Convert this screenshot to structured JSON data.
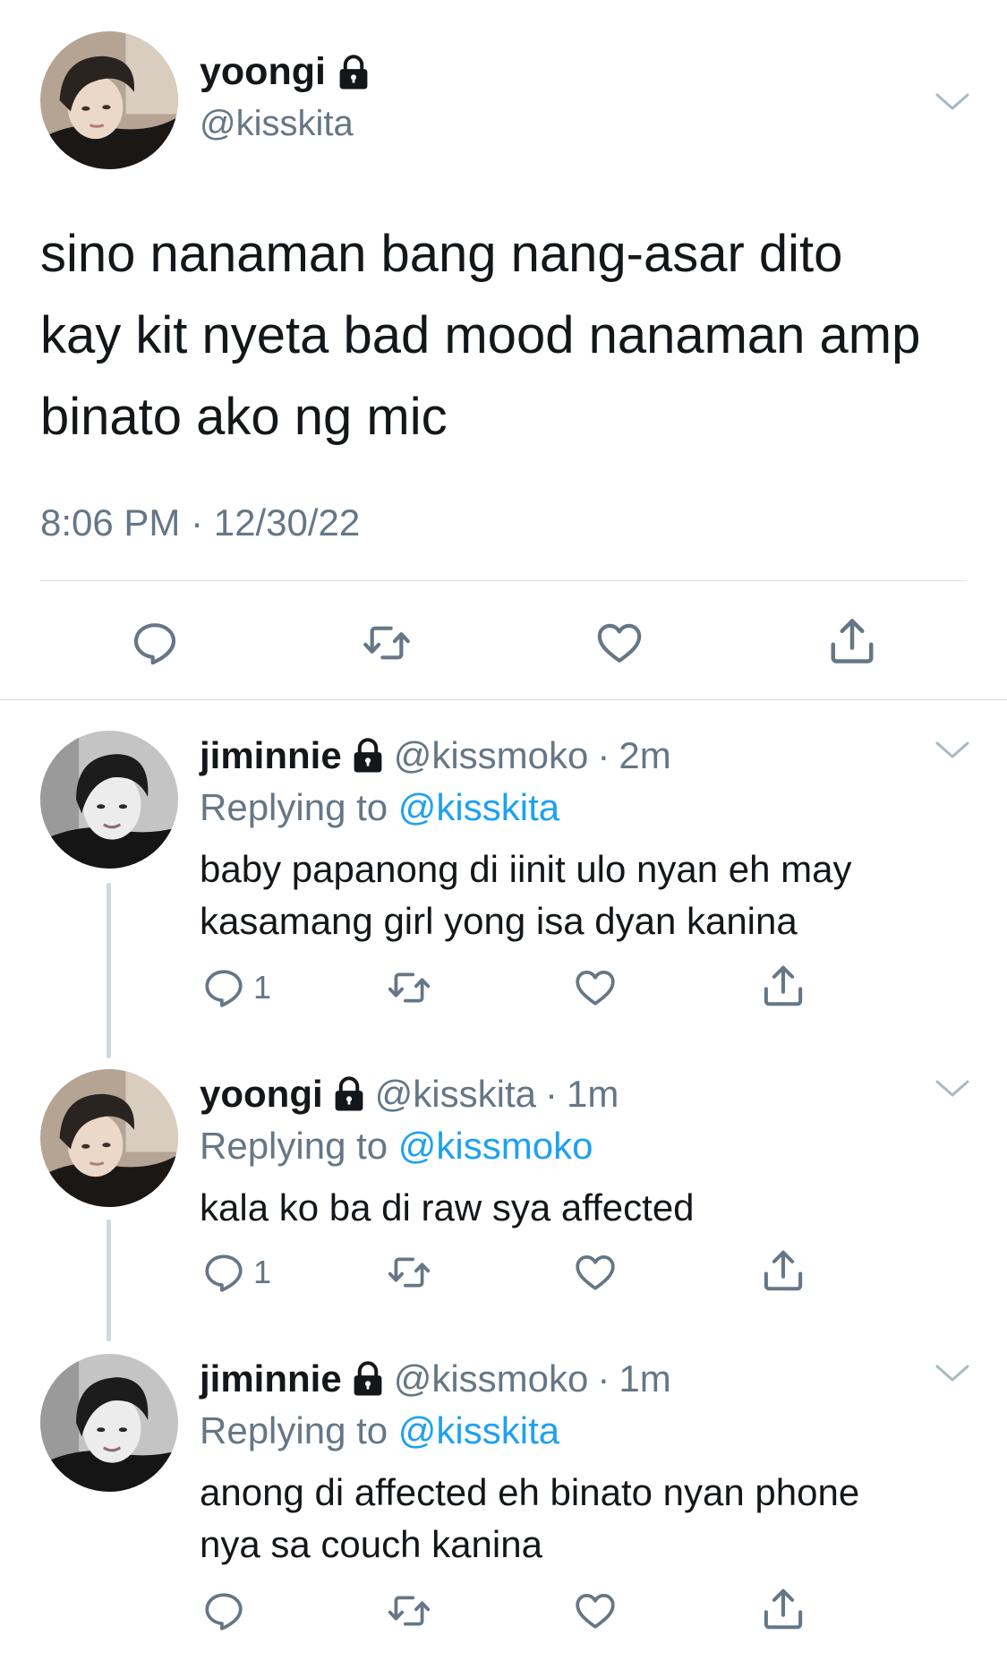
{
  "main_tweet": {
    "display_name": "yoongi",
    "handle": "@kisskita",
    "text": "sino nanaman bang nang-asar dito\nkay kit nyeta bad mood nanaman amp\nbinato ako ng mic",
    "timestamp": "8:06 PM · 12/30/22",
    "icons": [
      "lock-icon",
      "chevron-down-icon",
      "reply-icon",
      "retweet-icon",
      "like-icon",
      "share-icon"
    ]
  },
  "replies": [
    {
      "display_name": "jiminnie",
      "handle": "@kissmoko",
      "dot": "·",
      "time": "2m",
      "replying_prefix": "Replying to",
      "replying_to": "@kisskita",
      "text": "baby papanong di iinit ulo nyan eh may\nkasamang girl yong isa dyan kanina",
      "reply_count": "1"
    },
    {
      "display_name": "yoongi",
      "handle": "@kisskita",
      "dot": "·",
      "time": "1m",
      "replying_prefix": "Replying to",
      "replying_to": "@kissmoko",
      "text": "kala ko ba di raw sya affected",
      "reply_count": "1"
    },
    {
      "display_name": "jiminnie",
      "handle": "@kissmoko",
      "dot": "·",
      "time": "1m",
      "replying_prefix": "Replying to",
      "replying_to": "@kisskita",
      "text": "anong di affected eh binato nyan phone\nnya sa couch kanina",
      "reply_count": ""
    }
  ],
  "colors": {
    "text": "#14171a",
    "secondary": "#657786",
    "link": "#1da1f2",
    "divider": "#d6dde2"
  }
}
